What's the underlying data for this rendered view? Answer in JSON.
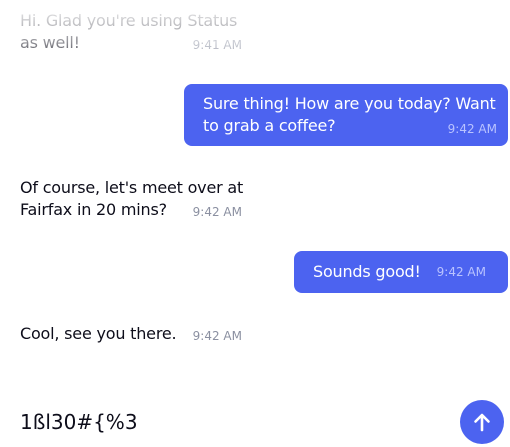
{
  "messages": [
    {
      "direction": "incoming",
      "text": "Hi. Glad you're using Status as well!",
      "time": "9:41 AM"
    },
    {
      "direction": "outgoing",
      "text": "Sure thing! How are you today? Want to grab a coffee?",
      "time": "9:42 AM"
    },
    {
      "direction": "incoming",
      "text": "Of course, let's meet over at Fairfax in 20 mins?",
      "time": "9:42 AM"
    },
    {
      "direction": "outgoing",
      "text": "Sounds good!",
      "time": "9:42 AM"
    },
    {
      "direction": "incoming",
      "text": "Cool, see you there.",
      "time": "9:42 AM"
    }
  ],
  "composer": {
    "text": "1ßl30#{%3"
  },
  "send_button": {
    "icon": "arrow-up-icon"
  },
  "colors": {
    "accent": "#4c63f0",
    "incoming_text": "#0d0d1a",
    "timestamp_gray": "#8b90a1",
    "outgoing_timestamp": "#b9c3ff"
  }
}
